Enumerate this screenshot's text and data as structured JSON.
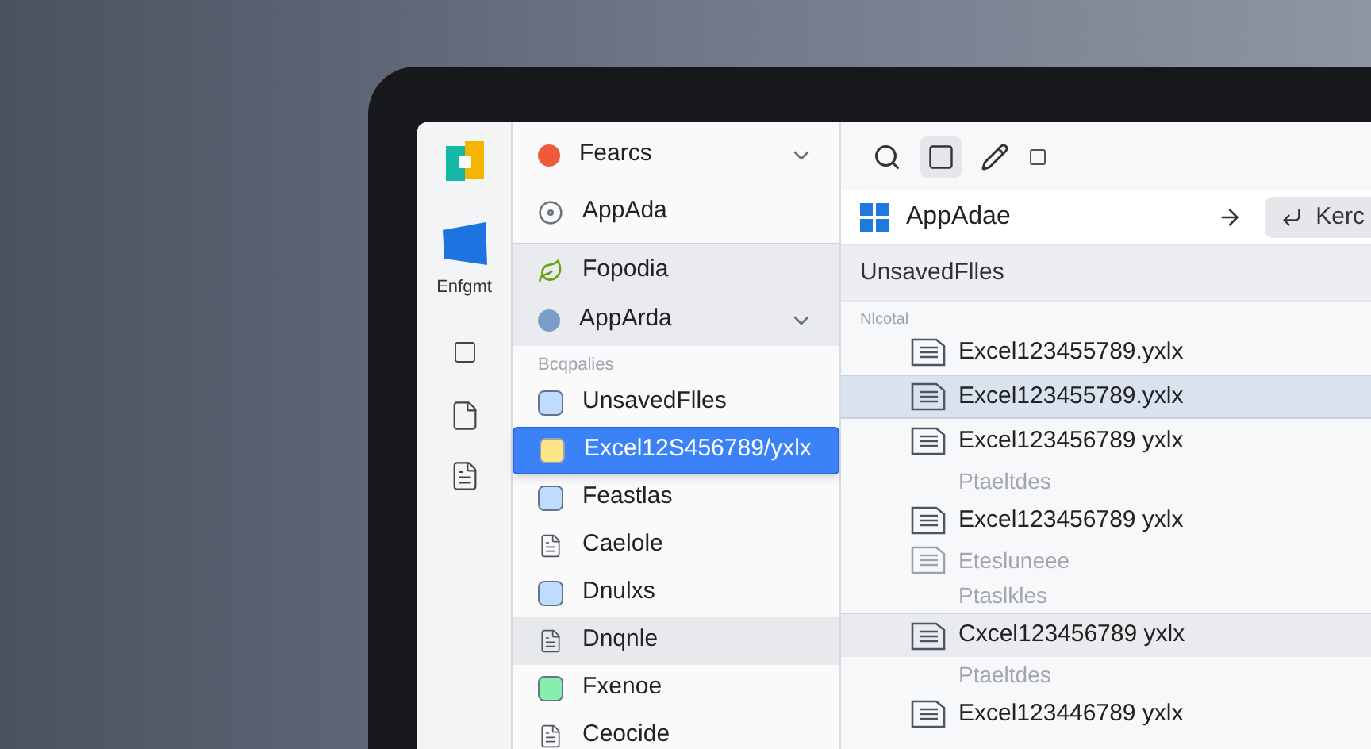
{
  "rail": {
    "label": "Enfgmt"
  },
  "nav": {
    "pinned": [
      {
        "label": "Fearcs",
        "kind": "group"
      },
      {
        "label": "AppAda",
        "kind": "item"
      }
    ],
    "recent": [
      {
        "label": "Fopodia",
        "kind": "item"
      },
      {
        "label": "AppArda",
        "kind": "group"
      }
    ],
    "section_label": "Bcqpalies",
    "items": [
      {
        "label": "UnsavedFlles",
        "selected": false,
        "hovered": false
      },
      {
        "label": "Excel12S456789/yxlx",
        "selected": true,
        "hovered": false
      },
      {
        "label": "Feastlas",
        "selected": false,
        "hovered": false
      },
      {
        "label": "Caelole",
        "selected": false,
        "hovered": false
      },
      {
        "label": "Dnulxs",
        "selected": false,
        "hovered": false
      },
      {
        "label": "Dnqnle",
        "selected": false,
        "hovered": true
      },
      {
        "label": "Fxenoe",
        "selected": false,
        "hovered": false
      },
      {
        "label": "Ceocide",
        "selected": false,
        "hovered": false
      }
    ]
  },
  "address": {
    "location": "AppAdae",
    "button": "Kerc"
  },
  "header": "UnsavedFlles",
  "group_label": "Nlcotal",
  "rows": [
    {
      "kind": "file",
      "text": "Excel123455789.yxlx",
      "selected": false,
      "hovered": false
    },
    {
      "kind": "file",
      "text": "Excel123455789.yxlx",
      "selected": true,
      "hovered": false
    },
    {
      "kind": "file",
      "text": "Excel123456789 yxlx",
      "selected": false,
      "hovered": false
    },
    {
      "kind": "detail",
      "text": "Ptaeltdes",
      "selected": false,
      "hovered": false
    },
    {
      "kind": "file",
      "text": "Excel123456789 yxlx",
      "selected": false,
      "hovered": false
    },
    {
      "kind": "detail_icon",
      "text": "Etesluneee",
      "selected": false,
      "hovered": false
    },
    {
      "kind": "detail",
      "text": "Ptaslkles",
      "selected": false,
      "hovered": false
    },
    {
      "kind": "file",
      "text": "Cxcel123456789 yxlx",
      "selected": false,
      "hovered": true
    },
    {
      "kind": "detail",
      "text": "Ptaeltdes",
      "selected": false,
      "hovered": false
    },
    {
      "kind": "file",
      "text": "Excel123446789 yxlx",
      "selected": false,
      "hovered": false
    }
  ]
}
